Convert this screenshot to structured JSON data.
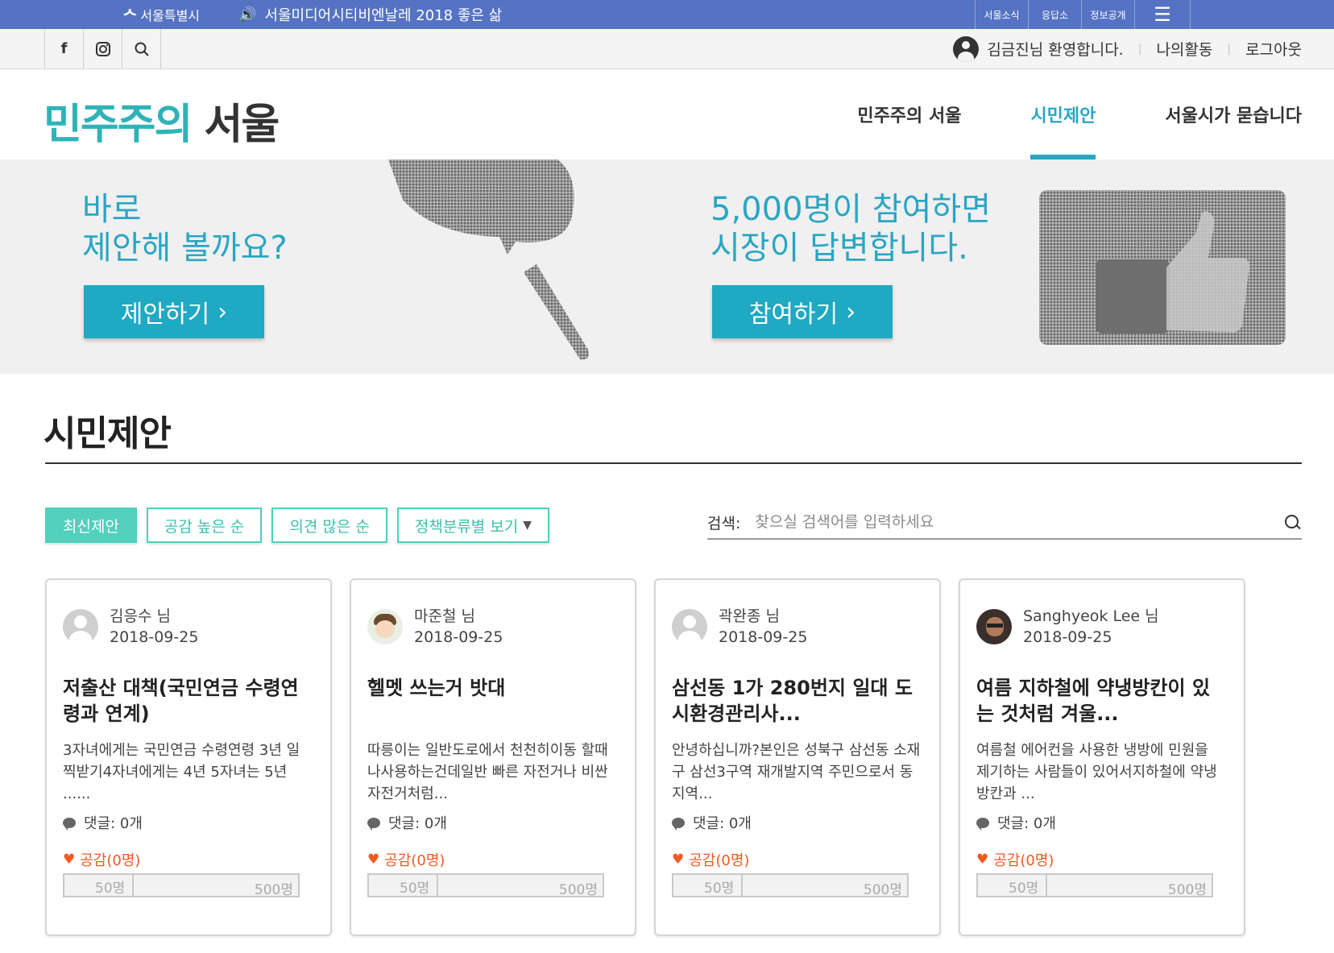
{
  "topbar": {
    "seoul_label": "서울특별시",
    "notice": "서울미디어시티비엔날레 2018 좋은 삶",
    "quick_links": [
      "서울소식",
      "응답소",
      "정보공개"
    ]
  },
  "util": {
    "welcome": "김금진님 환영합니다.",
    "my_activity": "나의활동",
    "logout": "로그아웃"
  },
  "header": {
    "brand_part1": "민주주의",
    "brand_part2": "서울",
    "nav": [
      "민주주의 서울",
      "시민제안",
      "서울시가 묻습니다"
    ]
  },
  "hero": {
    "left_title": "바로\n제안해 볼까요?",
    "left_button": "제안하기",
    "right_title": "5,000명이 참여하면\n시장이 답변합니다.",
    "right_button": "참여하기"
  },
  "section": {
    "title": "시민제안"
  },
  "filters": [
    "최신제안",
    "공감 높은 순",
    "의견 많은 순",
    "정책분류별 보기"
  ],
  "search": {
    "label": "검색:",
    "placeholder": "찾으실 검색어를 입력하세요"
  },
  "cards": [
    {
      "author": "김응수 님",
      "date": "2018-09-25",
      "title": "저출산 대책(국민연금 수령연령과 연계)",
      "desc": "3자녀에게는 국민연금 수령연령 3년 일찍받기4자녀에게는 4년 5자녀는 5년 ......",
      "comments": "댓글: 0개",
      "likes": "공감(0명)",
      "gauge_mid": "50명",
      "gauge_max": "500명"
    },
    {
      "author": "마준철 님",
      "date": "2018-09-25",
      "title": "헬멧 쓰는거 밧대",
      "desc": "따릉이는 일반도로에서 천천히이동 할때나사용하는건데일반 빠른 자전거나 비싼자전거처럼...",
      "comments": "댓글: 0개",
      "likes": "공감(0명)",
      "gauge_mid": "50명",
      "gauge_max": "500명"
    },
    {
      "author": "곽완종 님",
      "date": "2018-09-25",
      "title": "삼선동 1가 280번지 일대 도시환경관리사...",
      "desc": "안녕하십니까?본인은 성북구 삼선동 소재 구 삼선3구역 재개발지역 주민으로서 동지역...",
      "comments": "댓글: 0개",
      "likes": "공감(0명)",
      "gauge_mid": "50명",
      "gauge_max": "500명"
    },
    {
      "author": "Sanghyeok Lee 님",
      "date": "2018-09-25",
      "title": "여름 지하철에 약냉방칸이 있는 것처럼 겨울...",
      "desc": "여름철 에어컨을 사용한 냉방에 민원을 제기하는 사람들이 있어서지하철에 약냉방칸과 ...",
      "comments": "댓글: 0개",
      "likes": "공감(0명)",
      "gauge_mid": "50명",
      "gauge_max": "500명"
    }
  ],
  "icons": {
    "facebook": "facebook-icon",
    "instagram": "instagram-icon",
    "search": "search-icon",
    "menu": "menu-icon",
    "speaker": "speaker-icon",
    "heart": "heart-icon",
    "comment": "comment-icon"
  },
  "colors": {
    "topbar": "#5573c2",
    "teal": "#2fb3b6",
    "hero_button": "#1fa9c2",
    "filter": "#52cfbd",
    "like": "#f05a22"
  }
}
